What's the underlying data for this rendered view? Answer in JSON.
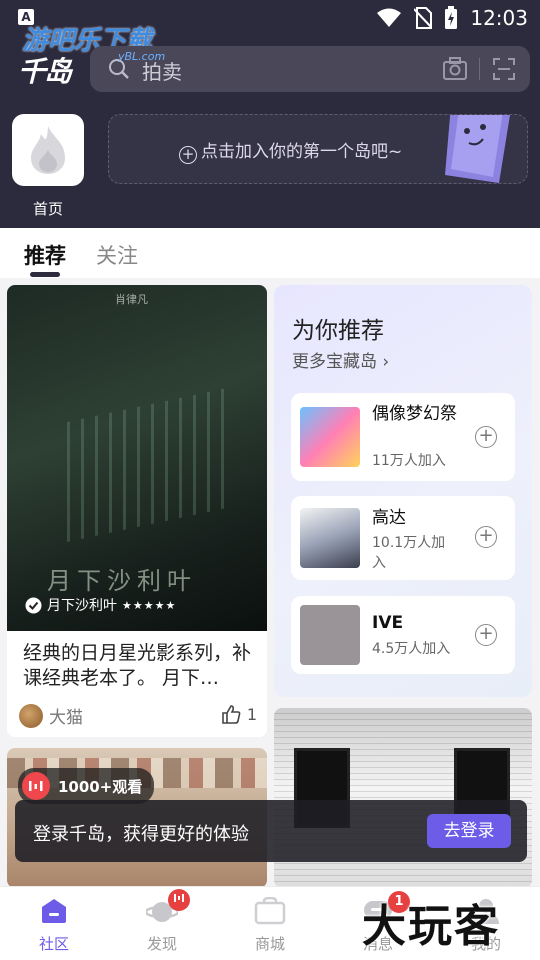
{
  "status_bar": {
    "time": "12:03",
    "indicator": "A"
  },
  "watermark": {
    "main": "游吧乐下载",
    "sub": "yBL.com",
    "corner": "大玩客"
  },
  "header": {
    "logo": "千岛",
    "search": {
      "placeholder": "拍卖"
    },
    "home": {
      "label": "首页"
    },
    "join_banner": {
      "text": "点击加入你的第一个岛吧~"
    }
  },
  "tabs": [
    {
      "label": "推荐",
      "active": true
    },
    {
      "label": "关注",
      "active": false
    }
  ],
  "feed": {
    "card1": {
      "poster_top": "肖律凡",
      "poster_title": "月下沙利叶",
      "source_tag": "月下沙利叶",
      "rating_stars": "★★★★★",
      "title": "经典的日月星光影系列，补课经典老本了。 月下…",
      "author": "大猫",
      "likes": "1"
    },
    "recommend": {
      "title": "为你推荐",
      "more": "更多宝藏岛",
      "items": [
        {
          "name": "偶像梦幻祭",
          "count": "11万人加入"
        },
        {
          "name": "高达",
          "count": "10.1万人加入"
        },
        {
          "name": "IVE",
          "count": "4.5万人加入"
        }
      ]
    },
    "card2": {
      "watch_badge": "1000+观看"
    }
  },
  "toast": {
    "text": "登录千岛，获得更好的体验",
    "button": "去登录"
  },
  "bottom_nav": [
    {
      "label": "社区",
      "active": true
    },
    {
      "label": "发现",
      "active": false
    },
    {
      "label": "商城",
      "active": false
    },
    {
      "label": "消息",
      "active": false,
      "badge": "1"
    },
    {
      "label": "我的",
      "active": false
    }
  ],
  "colors": {
    "header_bg": "#2c2a3d",
    "accent": "#6c5ce7",
    "badge": "#e74040"
  }
}
